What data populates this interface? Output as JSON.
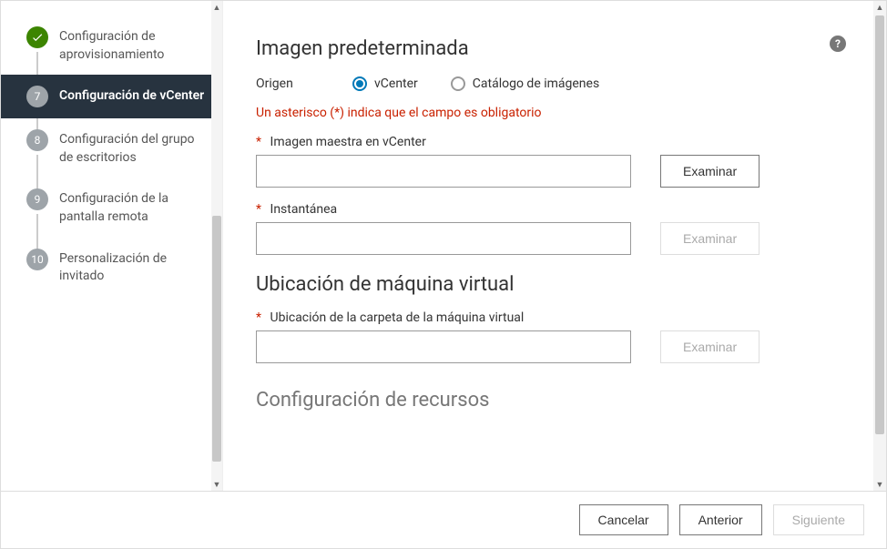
{
  "sidebar": {
    "steps": [
      {
        "num_label": "",
        "label": "Configuración de aprovisionamiento",
        "state": "done"
      },
      {
        "num_label": "7",
        "label": "Configuración de vCenter",
        "state": "active"
      },
      {
        "num_label": "8",
        "label": "Configuración del grupo de escritorios",
        "state": "pending"
      },
      {
        "num_label": "9",
        "label": "Configuración de la pantalla remota",
        "state": "pending"
      },
      {
        "num_label": "10",
        "label": "Personalización de invitado",
        "state": "pending"
      }
    ]
  },
  "main": {
    "section_title_default_image": "Imagen predeterminada",
    "origin_label": "Origen",
    "radio_vcenter": "vCenter",
    "radio_catalog": "Catálogo de imágenes",
    "selected_origin": "vcenter",
    "required_note": "Un asterisco (*) indica que el campo es obligatorio",
    "fields": {
      "master_image": {
        "label": "Imagen maestra en vCenter",
        "value": "",
        "browse_label": "Examinar",
        "browse_enabled": true
      },
      "snapshot": {
        "label": "Instantánea",
        "value": "",
        "browse_label": "Examinar",
        "browse_enabled": false
      },
      "vm_folder": {
        "label": "Ubicación de la carpeta de la máquina virtual",
        "value": "",
        "browse_label": "Examinar",
        "browse_enabled": false
      }
    },
    "section_title_vm_location": "Ubicación de máquina virtual",
    "section_title_resource_config": "Configuración de recursos"
  },
  "footer": {
    "cancel": "Cancelar",
    "previous": "Anterior",
    "next": "Siguiente",
    "next_enabled": false
  }
}
